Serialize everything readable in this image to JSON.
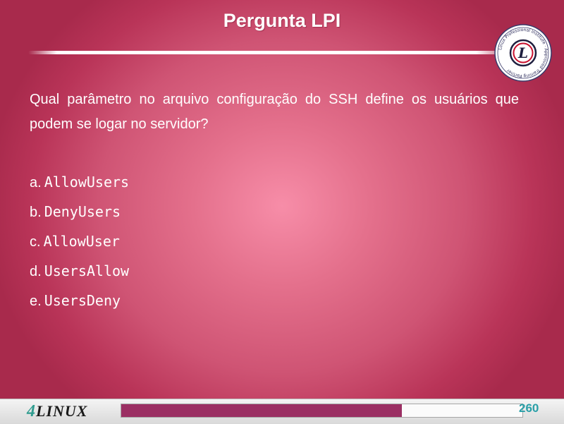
{
  "slide": {
    "title": "Pergunta LPI",
    "question": "Qual parâmetro no arquivo configuração do SSH define os usuários que podem se logar no servidor?",
    "options": [
      {
        "letter": "a.",
        "text": "AllowUsers"
      },
      {
        "letter": "b.",
        "text": "DenyUsers"
      },
      {
        "letter": "c.",
        "text": "AllowUser"
      },
      {
        "letter": "d.",
        "text": "UsersAllow"
      },
      {
        "letter": "e.",
        "text": "UsersDeny"
      }
    ],
    "badge": {
      "ring_text": "Linux Professional Institute · Approved Training Partner",
      "letter": "L"
    }
  },
  "footer": {
    "logo_digit": "4",
    "logo_word": "LINUX",
    "page_number": "260",
    "progress_fraction": 0.7,
    "accent_color": "#9b2f63",
    "page_number_color": "#2aa0a8"
  }
}
